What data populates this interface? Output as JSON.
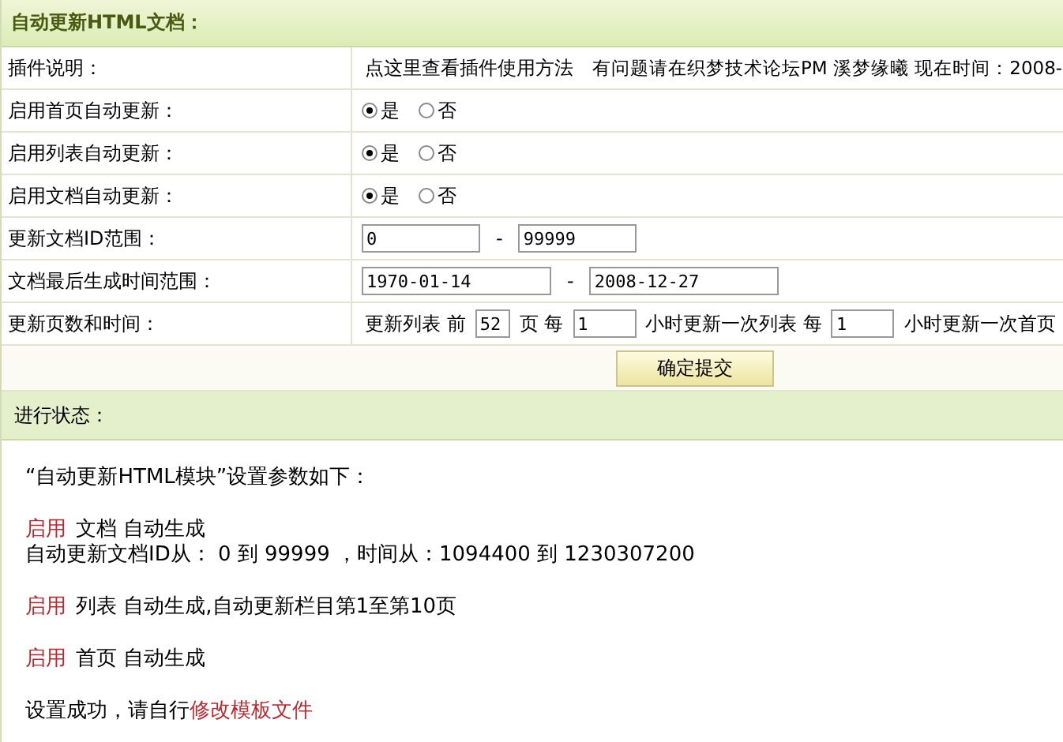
{
  "panel": {
    "title": "自动更新HTML文档："
  },
  "rows": [
    {
      "kind": "text",
      "label": "插件说明：",
      "link": "点这里查看插件使用方法",
      "text": "有问题请在织梦技术论坛PM 溪梦缘曦 现在时间：2008-"
    },
    {
      "kind": "radio",
      "label": "启用首页自动更新：",
      "options": [
        {
          "label": "是",
          "selected": true
        },
        {
          "label": "否",
          "selected": false
        }
      ]
    },
    {
      "kind": "radio",
      "label": "启用列表自动更新：",
      "options": [
        {
          "label": "是",
          "selected": true
        },
        {
          "label": "否",
          "selected": false
        }
      ]
    },
    {
      "kind": "radio",
      "label": "启用文档自动更新：",
      "options": [
        {
          "label": "是",
          "selected": true
        },
        {
          "label": "否",
          "selected": false
        }
      ]
    },
    {
      "kind": "range",
      "label": "更新文档ID范围：",
      "from": "0",
      "to": "99999",
      "sep": "-"
    },
    {
      "kind": "range",
      "label": "文档最后生成时间范围：",
      "from": "1970-01-14",
      "to": "2008-12-27",
      "sep": "-"
    },
    {
      "kind": "pages",
      "label": "更新页数和时间：",
      "parts": [
        {
          "text": "更新列表 前"
        },
        {
          "value": "52"
        },
        {
          "text": "页 每"
        },
        {
          "value": "1"
        },
        {
          "text": "小时更新一次列表 每"
        },
        {
          "value": "1"
        },
        {
          "text": "小时更新一次首页"
        }
      ]
    }
  ],
  "submit": "确定提交",
  "status": {
    "title": "进行状态：",
    "lines": [
      {
        "kind": "heading",
        "text": "“自动更新HTML模块”设置参数如下："
      },
      {
        "kind": "enabled",
        "flag": "启用",
        "text": "文档 自动生成",
        "detail": "自动更新文档ID从： 0 到 99999 ，时间从：1094400 到 1230307200"
      },
      {
        "kind": "enabled",
        "flag": "启用",
        "text": "列表 自动生成,自动更新栏目第1至第10页"
      },
      {
        "kind": "enabled",
        "flag": "启用",
        "text": "首页 自动生成"
      },
      {
        "kind": "link",
        "text": "设置成功，请自行",
        "link": "修改模板文件"
      }
    ]
  }
}
